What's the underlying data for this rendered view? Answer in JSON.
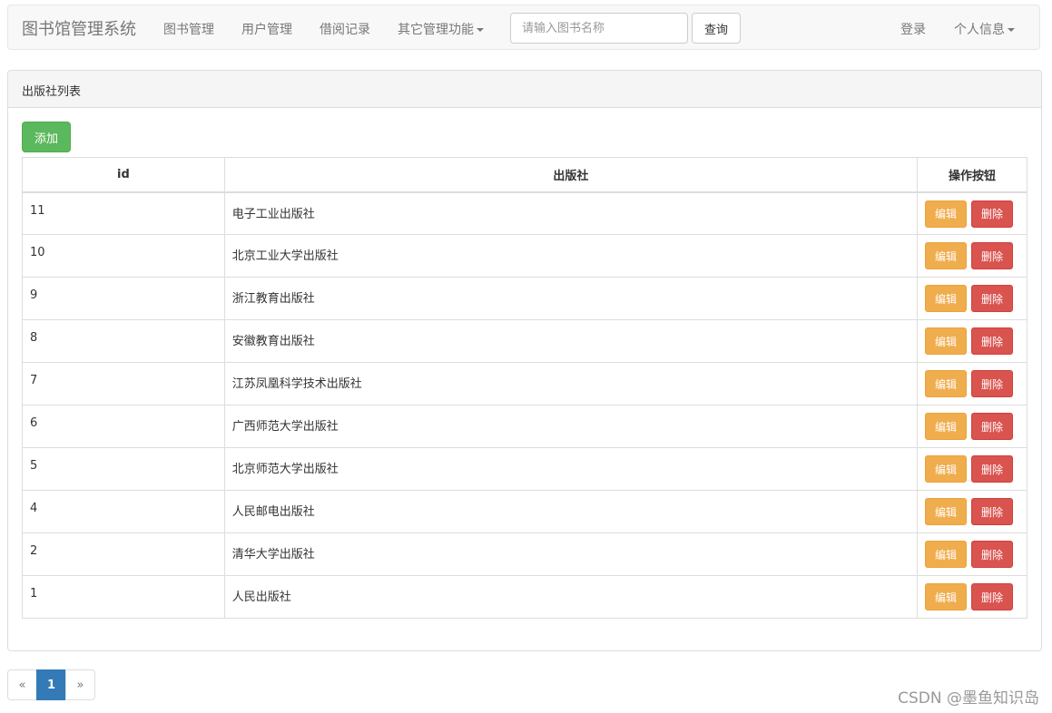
{
  "navbar": {
    "brand": "图书馆管理系统",
    "items": [
      {
        "label": "图书管理"
      },
      {
        "label": "用户管理"
      },
      {
        "label": "借阅记录"
      },
      {
        "label": "其它管理功能"
      }
    ],
    "search": {
      "placeholder": "请输入图书名称",
      "value": "",
      "button_label": "查询"
    },
    "right_items": [
      {
        "label": "登录"
      },
      {
        "label": "个人信息"
      }
    ]
  },
  "panel": {
    "title": "出版社列表",
    "add_label": "添加",
    "table": {
      "headers": [
        "id",
        "出版社",
        "操作按钮"
      ],
      "rows": [
        {
          "id": "11",
          "name": "电子工业出版社"
        },
        {
          "id": "10",
          "name": "北京工业大学出版社"
        },
        {
          "id": "9",
          "name": "浙江教育出版社"
        },
        {
          "id": "8",
          "name": "安徽教育出版社"
        },
        {
          "id": "7",
          "name": "江苏凤凰科学技术出版社"
        },
        {
          "id": "6",
          "name": "广西师范大学出版社"
        },
        {
          "id": "5",
          "name": "北京师范大学出版社"
        },
        {
          "id": "4",
          "name": "人民邮电出版社"
        },
        {
          "id": "2",
          "name": "清华大学出版社"
        },
        {
          "id": "1",
          "name": "人民出版社"
        }
      ],
      "edit_label": "编辑",
      "delete_label": "删除"
    }
  },
  "pagination": {
    "prev": "«",
    "current": "1",
    "next": "»"
  },
  "watermark": "CSDN @墨鱼知识岛",
  "colors": {
    "success": "#5cb85c",
    "warning": "#f0ad4e",
    "danger": "#d9534f",
    "primary": "#337ab7"
  }
}
